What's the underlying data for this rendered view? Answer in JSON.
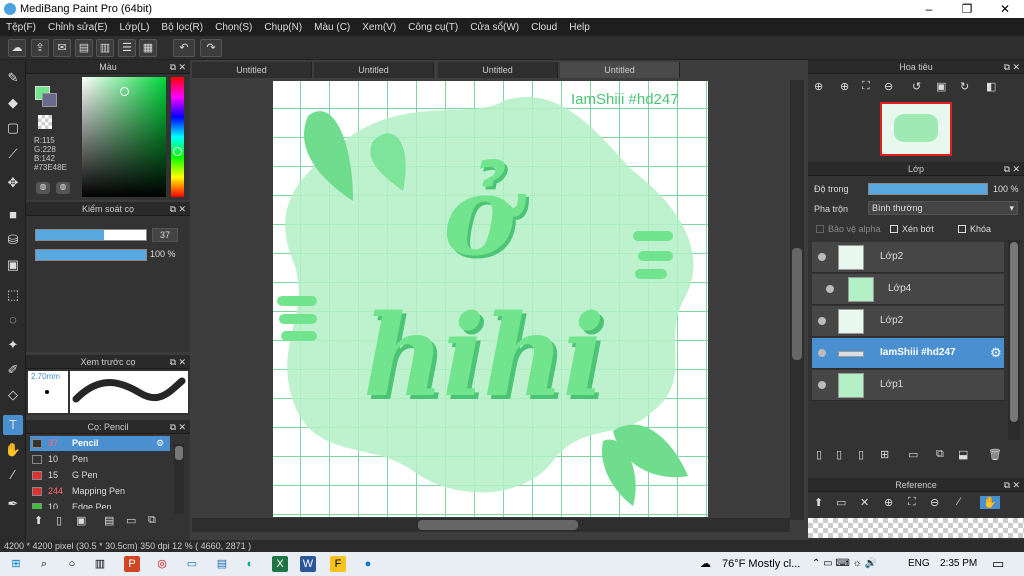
{
  "window": {
    "title": "MediBang Paint Pro (64bit)",
    "minimize": "–",
    "maximize": "❐",
    "close": "✕"
  },
  "menu": [
    "Tệp(F)",
    "Chỉnh sửa(E)",
    "Lớp(L)",
    "Bộ lọc(R)",
    "Chọn(S)",
    "Chụp(N)",
    "Màu (C)",
    "Xem(V)",
    "Công cụ(T)",
    "Cửa sổ(W)",
    "Cloud",
    "Help"
  ],
  "doc_tabs": [
    "Untitled",
    "Untitled",
    "Untitled",
    "Untitled"
  ],
  "color_panel": {
    "title": "Màu",
    "r": "R:115",
    "g": "G:228",
    "b": "B:142",
    "hex": "#73E48E",
    "fg": "#73e48e"
  },
  "brush_control": {
    "title": "Kiểm soát cọ",
    "size": "37",
    "opacity": "100 %"
  },
  "brush_preview": {
    "title": "Xem trước cọ",
    "size": "2.70mm"
  },
  "brush_list": {
    "title": "Cọ: Pencil",
    "items": [
      {
        "num": "37",
        "name": "Pencil",
        "color": "#333"
      },
      {
        "num": "10",
        "name": "Pen",
        "color": "#333"
      },
      {
        "num": "15",
        "name": "G Pen",
        "color": "#e03030"
      },
      {
        "num": "244",
        "name": "Mapping Pen",
        "color": "#e03030"
      },
      {
        "num": "10",
        "name": "Edge Pen",
        "color": "#3ec03e"
      }
    ]
  },
  "canvas": {
    "watermark": "IamShiii #hd247",
    "word_top": "ở",
    "word_main": "hihi"
  },
  "navigator": {
    "title": "Hoa tiêu"
  },
  "layers": {
    "title": "Lớp",
    "opacity_label": "Độ trong",
    "opacity_value": "100 %",
    "blend_label": "Pha trộn",
    "blend_value": "Bình thường",
    "protect_alpha": "Bảo vệ alpha",
    "clip": "Xén bớt",
    "lock": "Khóa",
    "rows": [
      {
        "name": "Lớp2"
      },
      {
        "name": "Lớp4"
      },
      {
        "name": "Lớp2"
      },
      {
        "name": "IamShiii #hd247"
      },
      {
        "name": "Lớp1"
      }
    ]
  },
  "reference": {
    "title": "Reference"
  },
  "status": {
    "text": "4200 * 4200 pixel   (30.5 * 30.5cm)   350 dpi   12 %   ( 4660, 2871 )"
  },
  "taskbar": {
    "weather": "76°F  Mostly cl...",
    "lang": "ENG",
    "time": "2:35 PM"
  }
}
